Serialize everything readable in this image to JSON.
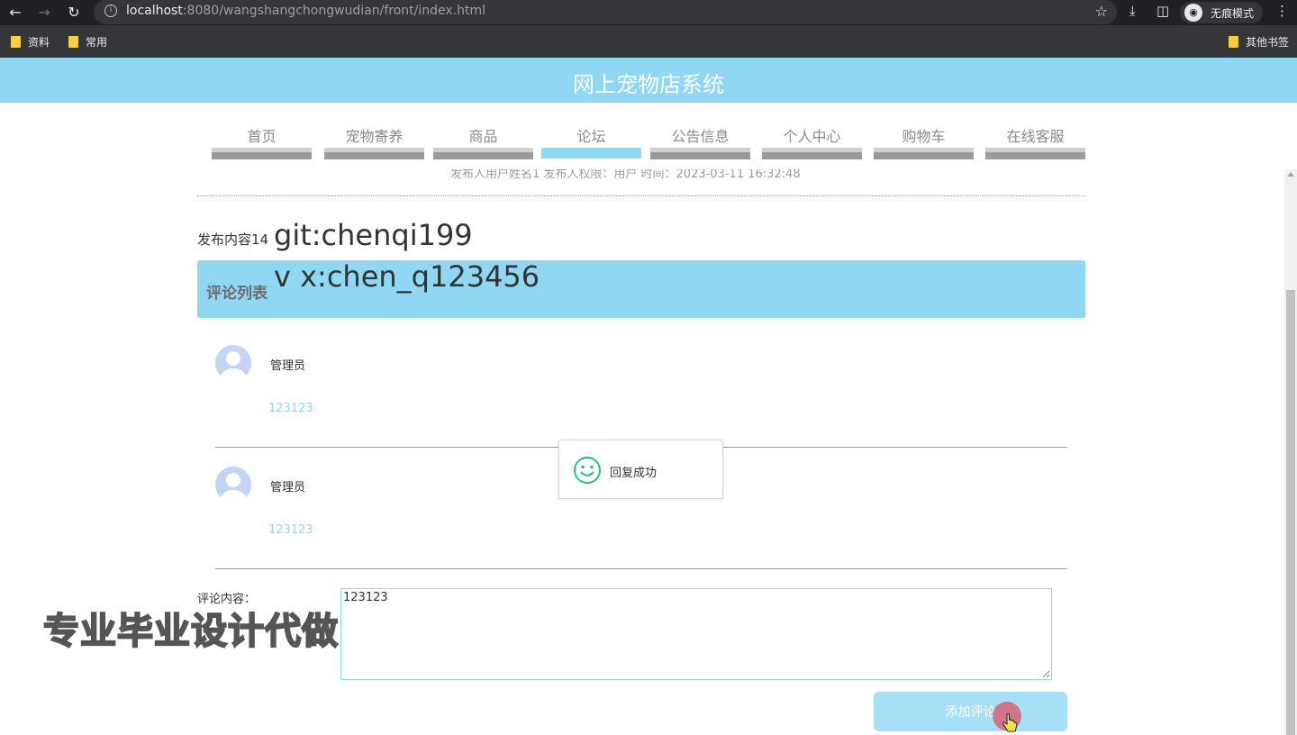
{
  "browser": {
    "url_host": "localhost",
    "url_path": ":8080/wangshangchongwudian/front/index.html",
    "incognito_label": "无痕模式",
    "bookmarks": [
      "资料",
      "常用"
    ],
    "other_bookmarks": "其他书签"
  },
  "site": {
    "title": "网上宠物店系统"
  },
  "nav": {
    "items": [
      "首页",
      "宠物寄养",
      "商品",
      "论坛",
      "公告信息",
      "个人中心",
      "购物车",
      "在线客服"
    ],
    "active_index": 3
  },
  "post": {
    "meta_partial": "发布人用户姓名1   发布人权限：用户   时间：2023-03-11 16:32:48",
    "content_label": "发布内容14"
  },
  "overlay": {
    "line1": "git:chenqi199",
    "line2": "v x:chen_q123456",
    "watermark": "专业毕业设计代做"
  },
  "comments": {
    "header": "评论列表",
    "items": [
      {
        "user": "管理员",
        "text": "123123"
      },
      {
        "user": "管理员",
        "text": "123123"
      }
    ]
  },
  "toast": {
    "message": "回复成功",
    "icon": "smile-icon"
  },
  "form": {
    "label": "评论内容：",
    "value": "123123",
    "submit_label": "添加评论"
  },
  "colors": {
    "accent": "#8fd7f3",
    "toast_icon": "#2bbf7e"
  }
}
